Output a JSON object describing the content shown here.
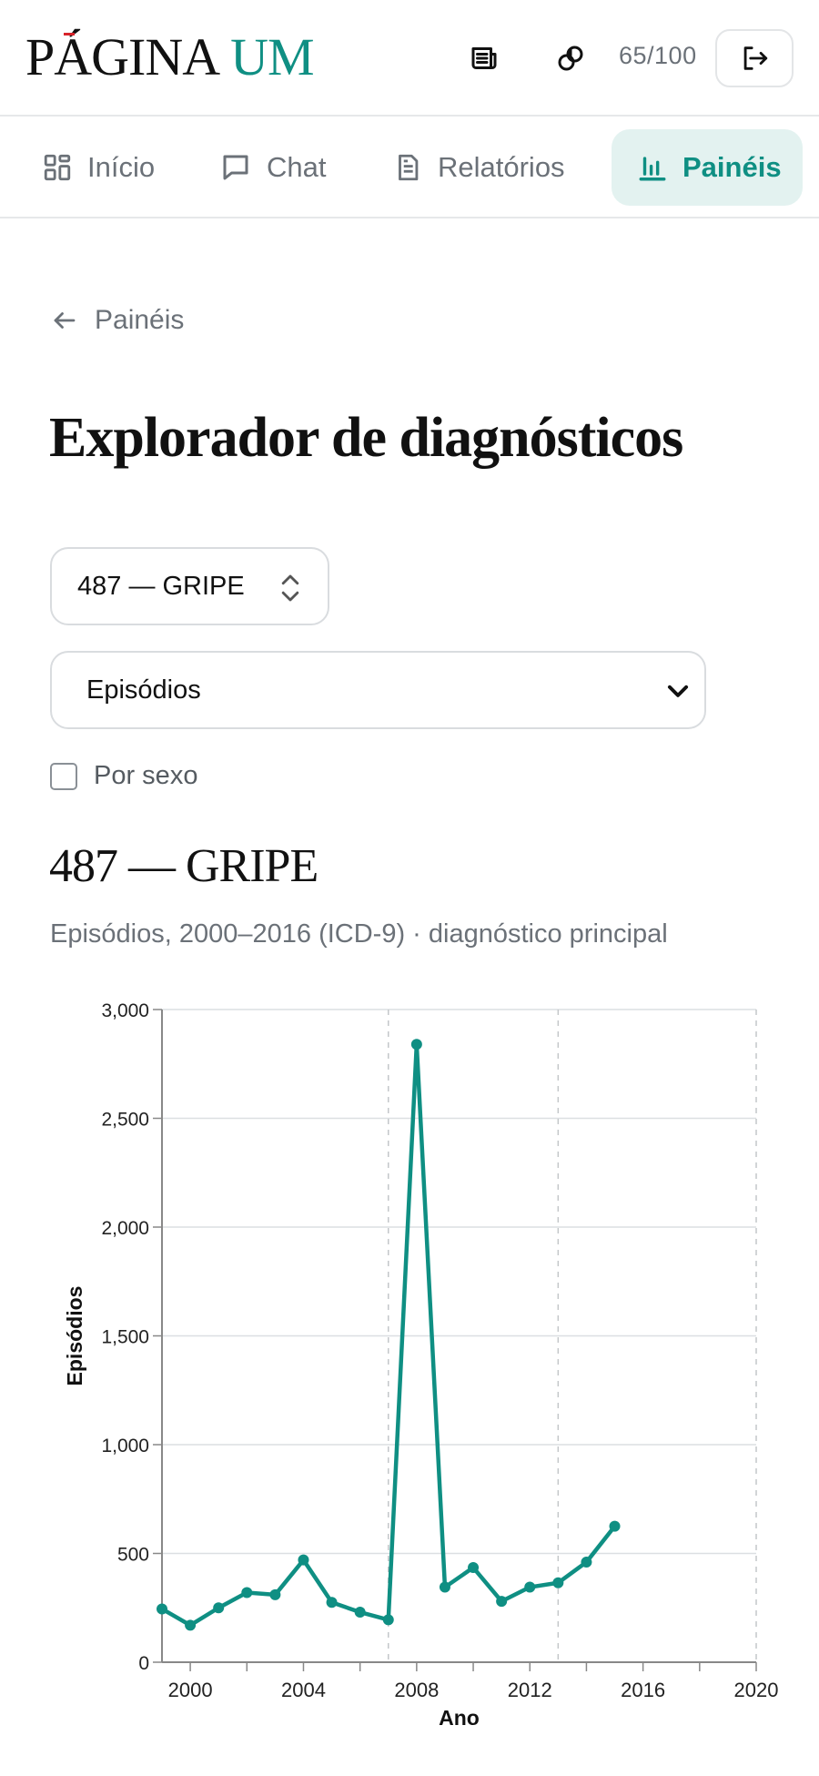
{
  "header": {
    "logo_part1": "PÁGINA",
    "logo_part2": "UM",
    "credits": "65/100",
    "icons": [
      "newspaper-icon",
      "link-icon",
      "logout-icon"
    ]
  },
  "nav": {
    "tabs": [
      {
        "label": "Início",
        "icon": "dashboard-icon"
      },
      {
        "label": "Chat",
        "icon": "chat-bubble-icon"
      },
      {
        "label": "Relatórios",
        "icon": "document-icon"
      },
      {
        "label": "Painéis",
        "icon": "bar-chart-icon",
        "active": true
      }
    ]
  },
  "breadcrumb": {
    "back_label": "Painéis"
  },
  "page": {
    "title": "Explorador de diagnósticos"
  },
  "controls": {
    "diagnosis_value": "487 — GRIPE",
    "metric_value": "Episódios",
    "by_sex_label": "Por sexo",
    "by_sex_checked": false
  },
  "chart_header": {
    "title": "487 — GRIPE",
    "subtitle": "Episódios, 2000–2016 (ICD-9) · diagnóstico principal"
  },
  "colors": {
    "accent": "#0f8f83",
    "accent_bg": "#e3f2f0"
  },
  "chart_data": {
    "type": "line",
    "x": [
      1999,
      2000,
      2001,
      2002,
      2003,
      2004,
      2005,
      2006,
      2007,
      2008,
      2009,
      2010,
      2011,
      2012,
      2013,
      2014,
      2015,
      2016
    ],
    "series": [
      {
        "values": [
          245,
          170,
          250,
          320,
          310,
          470,
          275,
          230,
          195,
          2840,
          345,
          435,
          280,
          345,
          365,
          460,
          625
        ]
      }
    ],
    "xlabel": "Ano",
    "ylabel": "Episódios",
    "xlim": [
      2000,
      2020
    ],
    "ylim": [
      0,
      3000
    ],
    "xticks": [
      "2000",
      "2004",
      "2008",
      "2012",
      "2016",
      "2020"
    ],
    "yticks": [
      "0",
      "500",
      "1,000",
      "1,500",
      "2,000",
      "2,500",
      "3,000"
    ],
    "reference_lines_x": [
      2007,
      2013,
      2020
    ],
    "grid": true
  }
}
